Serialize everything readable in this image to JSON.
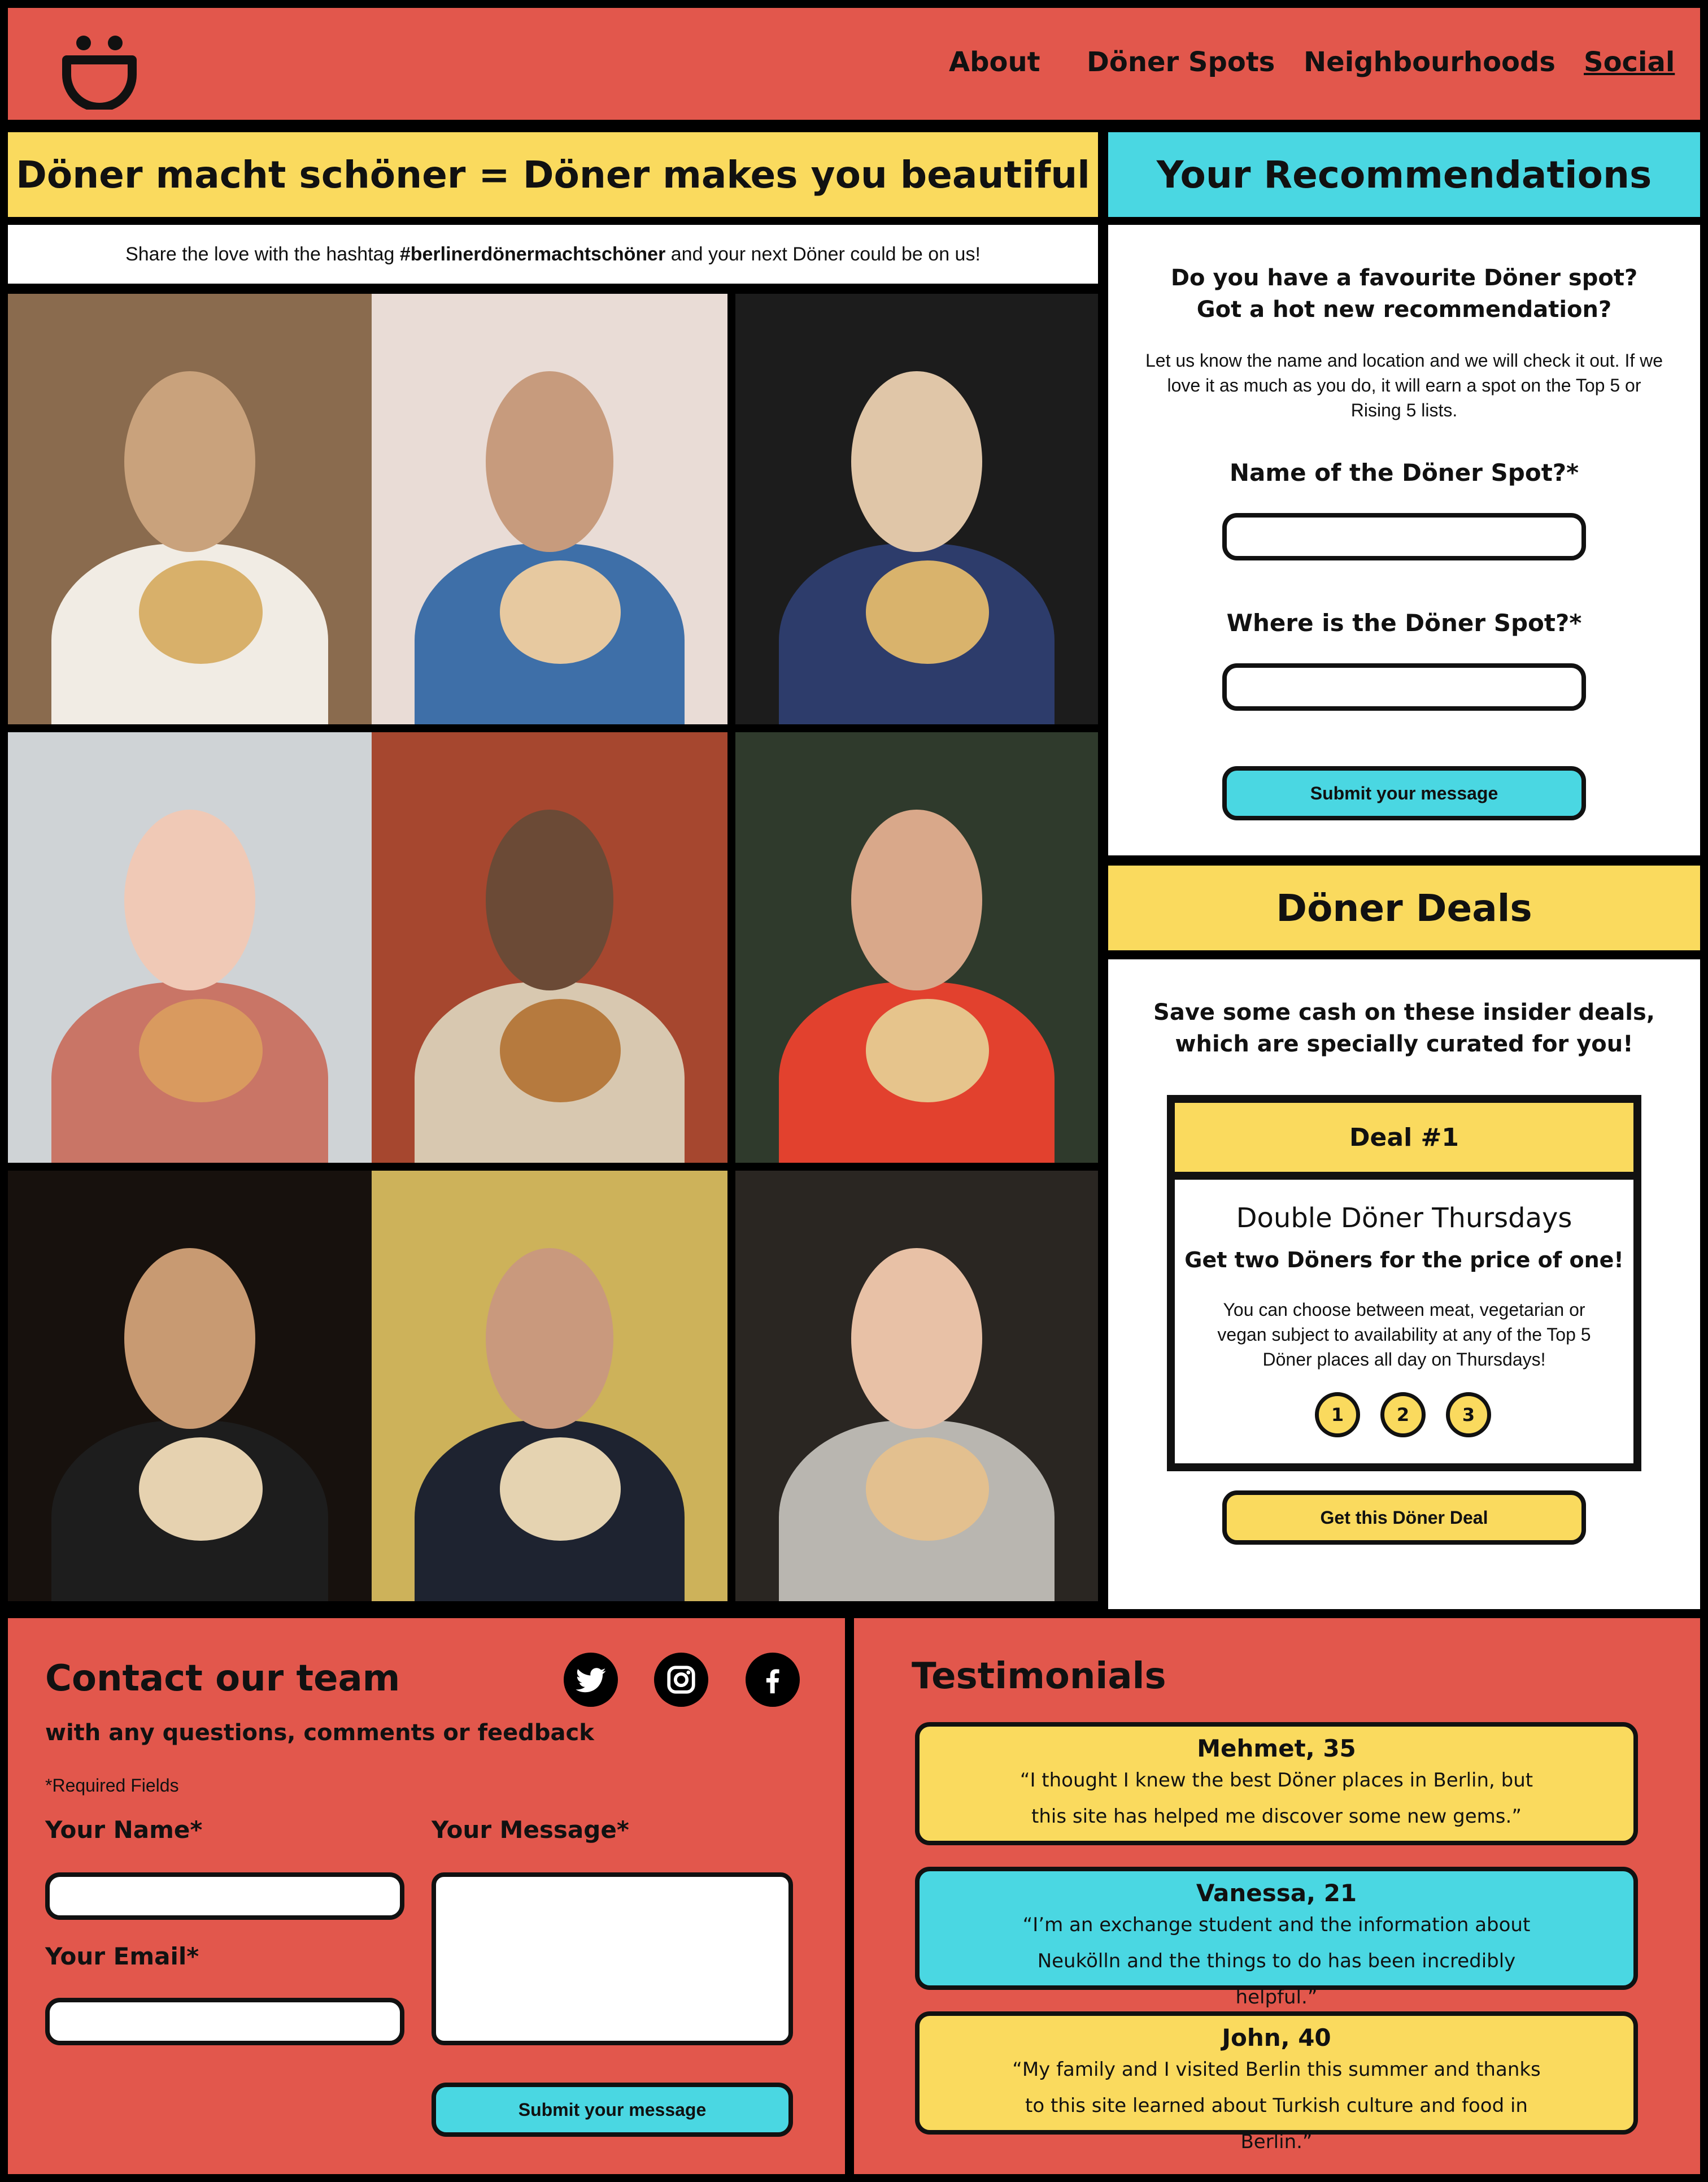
{
  "nav": {
    "logo_icon": "smiley-logo",
    "items": [
      "About",
      "Döner Spots",
      "Neighbourhoods",
      "Social"
    ]
  },
  "hero": {
    "title": "Döner macht schöner = Döner makes you beautiful",
    "share_pre": "Share the love with the hashtag ",
    "share_hashtag": "#berlinerdönermachtschöner",
    "share_post": " and your next Döner could be on us!"
  },
  "recommendations": {
    "title": "Your Recommendations",
    "q1": "Do you have a favourite Döner spot?",
    "q2": "Got a hot new recommendation?",
    "desc": "Let us know the name and location and we will check it out. If we love it as much as you do, it will earn a spot on the Top 5 or Rising 5 lists.",
    "name_label": "Name of the Döner Spot?*",
    "where_label": "Where is the Döner Spot?*",
    "submit": "Submit your message"
  },
  "deals": {
    "title": "Döner Deals",
    "subtitle": "Save some cash on these insider deals, which are specially curated for you!",
    "deal_header": "Deal #1",
    "deal_name": "Double Döner Thursdays",
    "deal_tagline": "Get two Döners for the price of one!",
    "deal_desc": "You can choose between meat, vegetarian or vegan subject to availability at any of the Top 5 Döner places all day on Thursdays!",
    "pages": [
      "1",
      "2",
      "3"
    ],
    "button": "Get this Döner Deal"
  },
  "contact": {
    "title": "Contact our team",
    "subtitle": "with any questions, comments or feedback",
    "required": "*Required Fields",
    "name_label": "Your Name*",
    "email_label": "Your Email*",
    "message_label": "Your Message*",
    "submit": "Submit your message",
    "social_icons": [
      "twitter-icon",
      "instagram-icon",
      "facebook-icon"
    ]
  },
  "testimonials": {
    "title": "Testimonials",
    "items": [
      {
        "name": "Mehmet, 35",
        "quote": "“I thought I knew the best Döner places in Berlin, but this site has helped me discover some new gems.”",
        "color": "#FADA5E"
      },
      {
        "name": "Vanessa, 21",
        "quote": "“I’m an exchange student and the information about Neukölln and the things to do has been incredibly helpful.”",
        "color": "#4AD7E2"
      },
      {
        "name": "John, 40",
        "quote": "“My family and I visited Berlin this summer and thanks to this site learned about Turkish culture and food in Berlin.”",
        "color": "#FADA5E"
      }
    ]
  },
  "colors": {
    "red": "#E2574C",
    "yellow": "#FADA5E",
    "cyan": "#4AD7E2",
    "border": "#000000"
  }
}
